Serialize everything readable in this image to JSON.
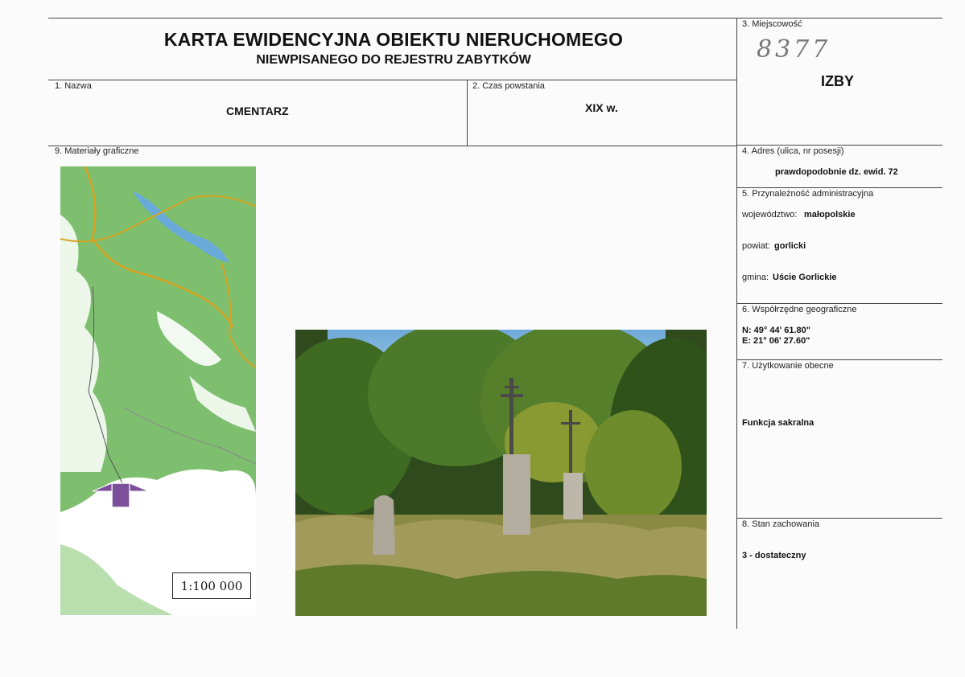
{
  "header": {
    "title": "KARTA EWIDENCYJNA OBIEKTU NIERUCHOMEGO",
    "subtitle": "NIEWPISANEGO DO REJESTRU ZABYTKÓW"
  },
  "fields": {
    "nazwa": {
      "label": "1. Nazwa",
      "value": "CMENTARZ"
    },
    "czas": {
      "label": "2. Czas powstania",
      "value": "XIX w."
    },
    "miejscowosc": {
      "label": "3. Miejscowość",
      "number": "8377",
      "value": "IZBY"
    },
    "adres": {
      "label": "4. Adres (ulica, nr posesji)",
      "value": "prawdopodobnie dz. ewid. 72"
    },
    "przynaleznosc": {
      "label": "5. Przynależność administracyjna",
      "wojewodztwo_label": "województwo:",
      "wojewodztwo": "małopolskie",
      "powiat_label": "powiat:",
      "powiat": "gorlicki",
      "gmina_label": "gmina:",
      "gmina": "Uście Gorlickie"
    },
    "wspolrzedne": {
      "label": "6. Współrzędne geograficzne",
      "n": "N: 49° 44' 61.80\"",
      "e": "E: 21° 06' 27.60\""
    },
    "uzytkowanie": {
      "label": "7. Użytkowanie obecne",
      "value": "Funkcja sakralna"
    },
    "stan": {
      "label": "8. Stan zachowania",
      "value": "3 - dostateczny"
    },
    "materialy": {
      "label": "9. Materiały graficzne",
      "scale": "1:100 000"
    }
  },
  "colors": {
    "map_forest": "#7dbf6f",
    "map_open": "#ffffff",
    "lake": "#6aaad8",
    "marker": "#7b4f9a",
    "road": "#d6a422"
  }
}
